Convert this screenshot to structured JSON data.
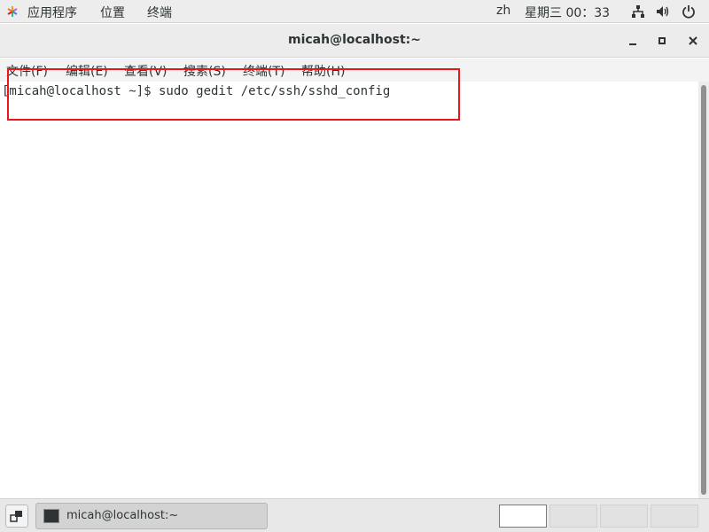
{
  "topbar": {
    "menus": [
      "应用程序",
      "位置",
      "终端"
    ],
    "lang": "zh",
    "datetime": "星期三 00：33",
    "icons": [
      "app-menu-icon",
      "network-icon",
      "volume-icon",
      "power-icon"
    ]
  },
  "window": {
    "title": "micah@localhost:~",
    "controls": [
      "minimize-icon",
      "maximize-icon",
      "close-icon"
    ]
  },
  "menubar": {
    "items": [
      "文件(F)",
      "编辑(E)",
      "查看(V)",
      "搜索(S)",
      "终端(T)",
      "帮助(H)"
    ]
  },
  "terminal": {
    "line1": "[micah@localhost ~]$ sudo gedit /etc/ssh/sshd_config"
  },
  "taskbar": {
    "task_label": "micah@localhost:~",
    "workspaces": 4,
    "active_workspace": 1
  },
  "colors": {
    "highlight": "#e8181a"
  }
}
